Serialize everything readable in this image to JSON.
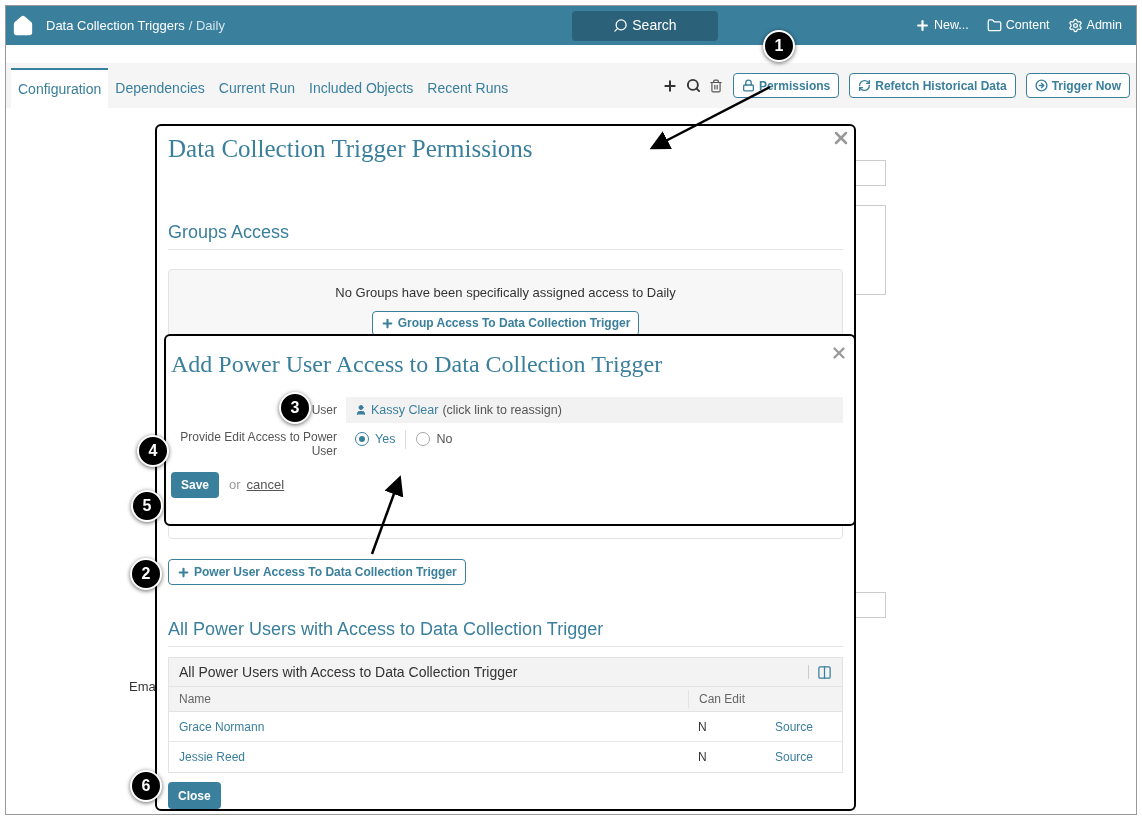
{
  "topbar": {
    "breadcrumb": "Data Collection Triggers",
    "separator": "/",
    "current": "Daily",
    "search": "Search",
    "actions": [
      "New...",
      "Content",
      "Admin"
    ]
  },
  "tabs": [
    {
      "label": "Configuration",
      "selected": true
    },
    {
      "label": "Dependencies",
      "selected": false
    },
    {
      "label": "Current Run",
      "selected": false
    },
    {
      "label": "Included Objects",
      "selected": false
    },
    {
      "label": "Recent Runs",
      "selected": false
    }
  ],
  "toolbar": {
    "buttons": [
      "Permissions",
      "Refetch Historical Data",
      "Trigger Now"
    ]
  },
  "background": {
    "label": "Ema"
  },
  "permissions_dialog": {
    "title": "Data Collection Trigger Permissions",
    "groups_heading": "Groups Access",
    "groups_empty": "No Groups have been specifically assigned access to Daily",
    "group_button": "Group Access To Data Collection Trigger",
    "power_user_button": "Power User Access To Data Collection Trigger",
    "power_users_heading": "All Power Users with Access to Data Collection Trigger",
    "table": {
      "title": "All Power Users with Access to Data Collection Trigger",
      "columns": [
        "Name",
        "Can Edit"
      ],
      "rows": [
        {
          "name": "Grace Normann",
          "can_edit": "N",
          "link": "Source"
        },
        {
          "name": "Jessie Reed",
          "can_edit": "N",
          "link": "Source"
        }
      ]
    },
    "close": "Close"
  },
  "add_dialog": {
    "title": "Add Power User Access to Data Collection Trigger",
    "user_label": "User",
    "user_name": "Kassy Clear",
    "user_hint": "(click link to reassign)",
    "edit_label": "Provide Edit Access to Power User",
    "options": [
      {
        "label": "Yes",
        "selected": true
      },
      {
        "label": "No",
        "selected": false
      }
    ],
    "save": "Save",
    "or": "or",
    "cancel": "cancel"
  },
  "callouts": [
    "1",
    "2",
    "3",
    "4",
    "5",
    "6"
  ]
}
